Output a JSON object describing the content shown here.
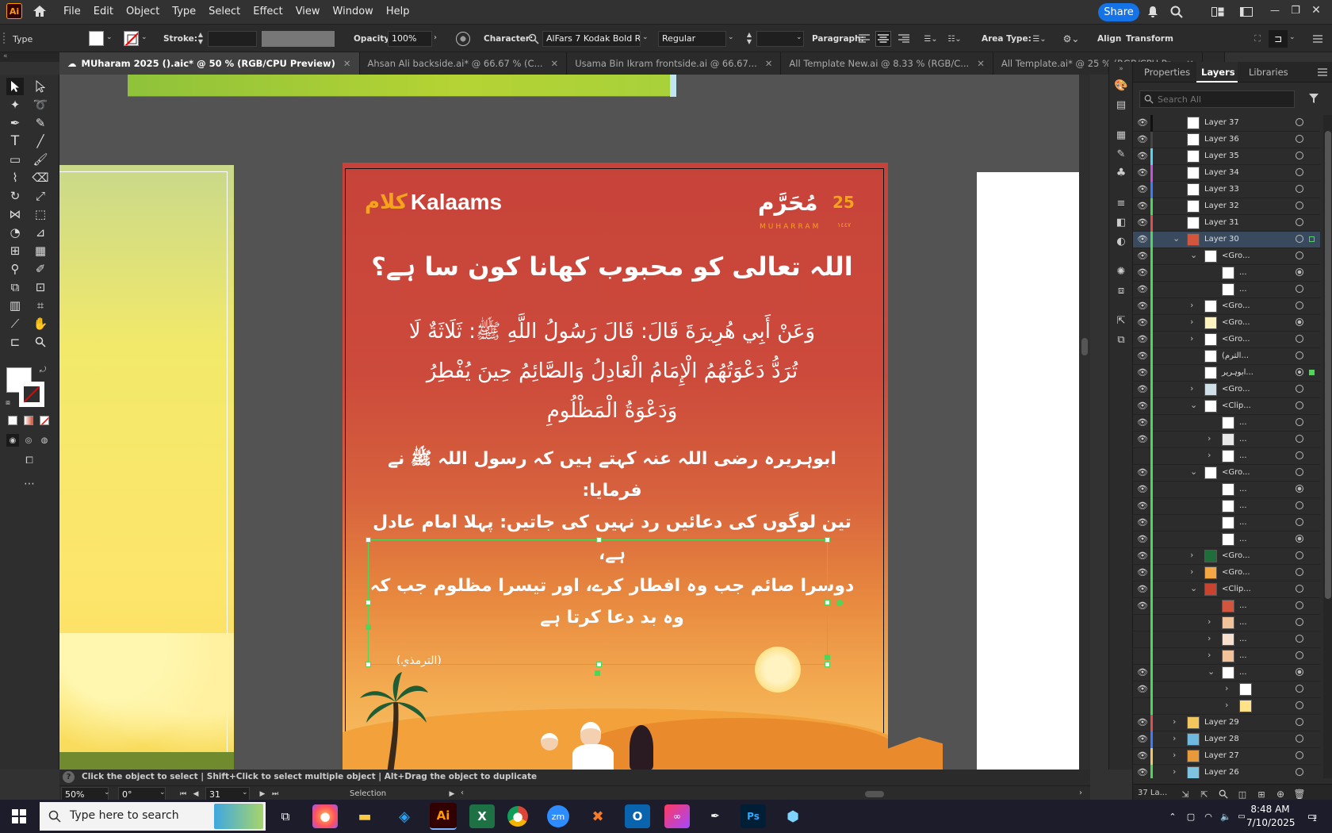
{
  "app": {
    "logo": "Ai"
  },
  "menu": [
    "File",
    "Edit",
    "Object",
    "Type",
    "Select",
    "Effect",
    "View",
    "Window",
    "Help"
  ],
  "share_label": "Share",
  "control": {
    "type_label": "Type",
    "stroke_label": "Stroke:",
    "opacity_label": "Opacity:",
    "opacity_value": "100%",
    "character_label": "Character:",
    "font_name": "AlFars 7 Kodak Bold Re...",
    "font_style": "Regular",
    "paragraph_label": "Paragraph:",
    "area_type_label": "Area Type:",
    "align_label": "Align",
    "transform_label": "Transform"
  },
  "tabs": [
    {
      "label": "MUharam 2025 ().aic* @ 50 % (RGB/CPU Preview)",
      "active": true
    },
    {
      "label": "Ahsan Ali backside.ai* @ 66.67 % (C...",
      "active": false
    },
    {
      "label": "Usama Bin Ikram frontside.ai @ 66.67...",
      "active": false
    },
    {
      "label": "All Template New.ai @ 8.33 % (RGB/C...",
      "active": false
    },
    {
      "label": "All Template.ai* @ 25 % (RGB/CPU Pr...",
      "active": false
    }
  ],
  "artboard": {
    "brand": "Kalaams",
    "brand_arabic": "كلام",
    "muharram_arabic": "مُحَرَّم",
    "muharram_number": "25",
    "muharram_latin": "MUHARRAM",
    "muharram_year": "١٤٤٧",
    "question": "اللہ تعالی کو محبوب کھانا کون سا ہے؟",
    "hadith_lines": [
      "وَعَنْ أَبِي هُرِيرَةَ قَالَ: قَالَ رَسُولُ اللَّهِ ﷺ: ثَلَاثَةٌ لَا",
      "تُرَدُّ دَعْوَتُهُمُ الْإِمَامُ الْعَادِلُ وَالصَّائِمُ حِينَ يُفْطِرُ",
      "وَدَعْوَةُ الْمَظْلُومِ"
    ],
    "translation_lines": [
      "ابوہریرہ رضی اللہ عنہ کہتے ہیں کہ رسول اللہ ﷺ نے فرمایا:",
      "تین لوگوں کی دعائیں رد نہیں کی جاتیں: پہلا امام عادل ہے،",
      "دوسرا صائم جب وہ افطار کرے، اور تیسرا مظلوم جب کہ",
      "وہ بد دعا کرتا ہے"
    ],
    "reference": "(الترمذي)"
  },
  "panel": {
    "tabs": [
      "Properties",
      "Layers",
      "Libraries"
    ],
    "active_tab": "Layers",
    "search_placeholder": "Search All",
    "footer_count": "37 La..."
  },
  "layers": [
    {
      "name": "Layer 37",
      "indent": 0,
      "color": "#111111",
      "arrow": "",
      "thumb": "#ffffff",
      "target": "ring",
      "eye": true
    },
    {
      "name": "Layer 36",
      "indent": 0,
      "color": "#444444",
      "arrow": "",
      "thumb": "#ffffff",
      "target": "ring",
      "eye": true
    },
    {
      "name": "Layer 35",
      "indent": 0,
      "color": "#4fd6f0",
      "arrow": "",
      "thumb": "#ffffff",
      "target": "ring",
      "eye": true
    },
    {
      "name": "Layer 34",
      "indent": 0,
      "color": "#c84fe0",
      "arrow": "",
      "thumb": "#ffffff",
      "target": "ring",
      "eye": true
    },
    {
      "name": "Layer 33",
      "indent": 0,
      "color": "#3a7bff",
      "arrow": "",
      "thumb": "#ffffff",
      "target": "ring",
      "eye": true
    },
    {
      "name": "Layer 32",
      "indent": 0,
      "color": "#4fd65a",
      "arrow": "",
      "thumb": "#ffffff",
      "target": "ring",
      "eye": true
    },
    {
      "name": "Layer 31",
      "indent": 0,
      "color": "#e04f4f",
      "arrow": "",
      "thumb": "#ffffff",
      "target": "ring",
      "eye": true
    },
    {
      "name": "Layer 30",
      "indent": 0,
      "color": "#4fd65a",
      "arrow": "v",
      "thumb": "#d2553e",
      "target": "ring",
      "eye": true,
      "selected": true
    },
    {
      "name": "<Gro...",
      "indent": 1,
      "color": "#4fd65a",
      "arrow": "v",
      "thumb": "#ffffff",
      "target": "ring",
      "eye": true
    },
    {
      "name": "...",
      "indent": 2,
      "color": "#4fd65a",
      "arrow": "",
      "thumb": "#ffffff",
      "target": "fill",
      "eye": true
    },
    {
      "name": "...",
      "indent": 2,
      "color": "#4fd65a",
      "arrow": "",
      "thumb": "#ffffff",
      "target": "ring",
      "eye": true
    },
    {
      "name": "<Gro...",
      "indent": 1,
      "color": "#4fd65a",
      "arrow": ">",
      "thumb": "#ffffff",
      "target": "ring",
      "eye": true
    },
    {
      "name": "<Gro...",
      "indent": 1,
      "color": "#4fd65a",
      "arrow": ">",
      "thumb": "#fff3c0",
      "target": "fill",
      "eye": true
    },
    {
      "name": "<Gro...",
      "indent": 1,
      "color": "#4fd65a",
      "arrow": ">",
      "thumb": "#ffffff",
      "target": "ring",
      "eye": true
    },
    {
      "name": "(الترم...",
      "indent": 1,
      "color": "#4fd65a",
      "arrow": "",
      "thumb": "#ffffff",
      "target": "ring",
      "eye": true
    },
    {
      "name": "ابوہریر...",
      "indent": 1,
      "color": "#4fd65a",
      "arrow": "",
      "thumb": "#ffffff",
      "target": "double",
      "eye": true
    },
    {
      "name": "<Gro...",
      "indent": 1,
      "color": "#4fd65a",
      "arrow": ">",
      "thumb": "#cfe0e8",
      "target": "ring",
      "eye": true
    },
    {
      "name": "<Clip...",
      "indent": 1,
      "color": "#4fd65a",
      "arrow": "v",
      "thumb": "#ffffff",
      "target": "ring",
      "eye": true
    },
    {
      "name": "...",
      "indent": 2,
      "color": "#4fd65a",
      "arrow": "",
      "thumb": "#ffffff",
      "target": "ring",
      "eye": true
    },
    {
      "name": "...",
      "indent": 2,
      "color": "#4fd65a",
      "arrow": ">",
      "thumb": "#e8e8e8",
      "target": "ring",
      "eye": true
    },
    {
      "name": "...",
      "indent": 2,
      "color": "#4fd65a",
      "arrow": ">",
      "thumb": "#ffffff",
      "target": "ring",
      "eye": false
    },
    {
      "name": "<Gro...",
      "indent": 1,
      "color": "#4fd65a",
      "arrow": "v",
      "thumb": "#ffffff",
      "target": "ring",
      "eye": true
    },
    {
      "name": "...",
      "indent": 2,
      "color": "#4fd65a",
      "arrow": "",
      "thumb": "#ffffff",
      "target": "fill",
      "eye": true
    },
    {
      "name": "...",
      "indent": 2,
      "color": "#4fd65a",
      "arrow": "",
      "thumb": "#ffffff",
      "target": "ring",
      "eye": true
    },
    {
      "name": "...",
      "indent": 2,
      "color": "#4fd65a",
      "arrow": "",
      "thumb": "#ffffff",
      "target": "ring",
      "eye": true
    },
    {
      "name": "...",
      "indent": 2,
      "color": "#4fd65a",
      "arrow": "",
      "thumb": "#ffffff",
      "target": "fill",
      "eye": true
    },
    {
      "name": "<Gro...",
      "indent": 1,
      "color": "#4fd65a",
      "arrow": ">",
      "thumb": "#1f6d3a",
      "target": "ring",
      "eye": true
    },
    {
      "name": "<Gro...",
      "indent": 1,
      "color": "#4fd65a",
      "arrow": ">",
      "thumb": "#f4a742",
      "target": "ring",
      "eye": true
    },
    {
      "name": "<Clip...",
      "indent": 1,
      "color": "#4fd65a",
      "arrow": "v",
      "thumb": "#c8442e",
      "target": "ring",
      "eye": true
    },
    {
      "name": "...",
      "indent": 2,
      "color": "#4fd65a",
      "arrow": "",
      "thumb": "#d2553e",
      "target": "ring",
      "eye": true
    },
    {
      "name": "...",
      "indent": 2,
      "color": "#4fd65a",
      "arrow": ">",
      "thumb": "#f2c29a",
      "target": "ring",
      "eye": false
    },
    {
      "name": "...",
      "indent": 2,
      "color": "#4fd65a",
      "arrow": ">",
      "thumb": "#f7e0d0",
      "target": "ring",
      "eye": false
    },
    {
      "name": "...",
      "indent": 2,
      "color": "#4fd65a",
      "arrow": ">",
      "thumb": "#f2c29a",
      "target": "ring",
      "eye": false
    },
    {
      "name": "...",
      "indent": 2,
      "color": "#4fd65a",
      "arrow": "v",
      "thumb": "#ffffff",
      "target": "fill",
      "eye": true
    },
    {
      "name": "",
      "indent": 3,
      "color": "#4fd65a",
      "arrow": ">",
      "thumb": "#ffffff",
      "target": "ring",
      "eye": true
    },
    {
      "name": "",
      "indent": 3,
      "color": "#4fd65a",
      "arrow": ">",
      "thumb": "#ffe28a",
      "target": "ring",
      "eye": false
    },
    {
      "name": "Layer 29",
      "indent": 0,
      "color": "#e04f4f",
      "arrow": ">",
      "thumb": "#f2c75e",
      "target": "ring",
      "eye": true
    },
    {
      "name": "Layer 28",
      "indent": 0,
      "color": "#3a7bff",
      "arrow": ">",
      "thumb": "#6fb9e0",
      "target": "ring",
      "eye": true
    },
    {
      "name": "Layer 27",
      "indent": 0,
      "color": "#f2c75e",
      "arrow": ">",
      "thumb": "#e89a3a",
      "target": "ring",
      "eye": true
    },
    {
      "name": "Layer 26",
      "indent": 0,
      "color": "#4fd65a",
      "arrow": ">",
      "thumb": "#7ec3e0",
      "target": "ring",
      "eye": true
    }
  ],
  "status": {
    "hint": "Click the object to select  |  Shift+Click to select multiple object  |  Alt+Drag the object to duplicate",
    "zoom": "50%",
    "rotation": "0°",
    "artboard_number": "31",
    "tool": "Selection"
  },
  "taskbar": {
    "search_placeholder": "Type here to search",
    "time": "8:48 AM",
    "date": "7/10/2025",
    "notification_count": "1"
  }
}
